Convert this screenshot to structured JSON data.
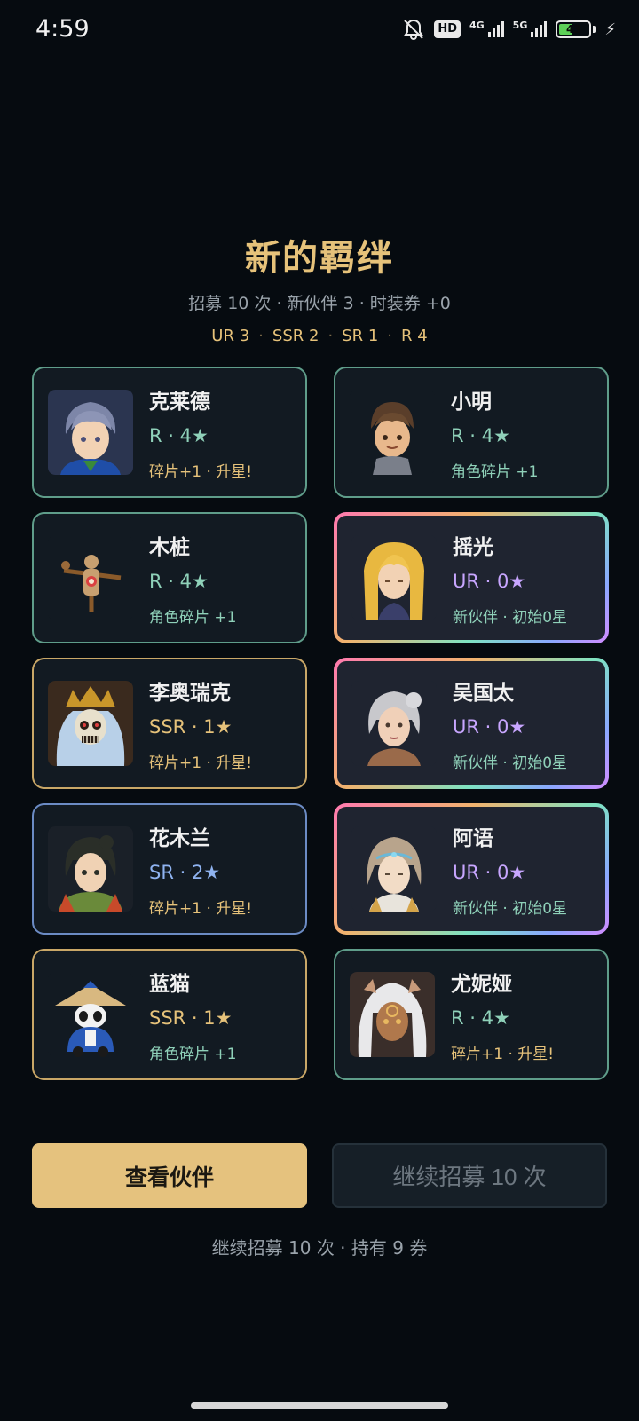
{
  "status_bar": {
    "time": "4:59",
    "hd_label": "HD",
    "net1": "4G",
    "net2": "5G",
    "battery": "43",
    "icons": [
      "bell-off-icon",
      "hd-icon",
      "signal-4g-icon",
      "signal-5g-icon",
      "battery-icon",
      "charging-icon"
    ]
  },
  "title": "新的羁绊",
  "summary": "招募 10 次 · 新伙伴 3 · 时装券 +0",
  "rarity_counts": [
    {
      "label": "UR 3"
    },
    {
      "label": "SSR 2"
    },
    {
      "label": "SR 1"
    },
    {
      "label": "R 4"
    }
  ],
  "cards": [
    {
      "name": "克莱德",
      "rank": "R · 4★",
      "rarity": "r",
      "note": "碎片+1 · 升星!",
      "note_color": "gold"
    },
    {
      "name": "小明",
      "rank": "R · 4★",
      "rarity": "r",
      "note": "角色碎片 +1",
      "note_color": "green"
    },
    {
      "name": "木桩",
      "rank": "R · 4★",
      "rarity": "r",
      "note": "角色碎片 +1",
      "note_color": "green"
    },
    {
      "name": "摇光",
      "rank": "UR · 0★",
      "rarity": "ur",
      "note": "新伙伴 · 初始0星",
      "note_color": "green"
    },
    {
      "name": "李奥瑞克",
      "rank": "SSR · 1★",
      "rarity": "ssr",
      "note": "碎片+1 · 升星!",
      "note_color": "gold"
    },
    {
      "name": "吴国太",
      "rank": "UR · 0★",
      "rarity": "ur",
      "note": "新伙伴 · 初始0星",
      "note_color": "green"
    },
    {
      "name": "花木兰",
      "rank": "SR · 2★",
      "rarity": "sr",
      "note": "碎片+1 · 升星!",
      "note_color": "gold"
    },
    {
      "name": "阿语",
      "rank": "UR · 0★",
      "rarity": "ur",
      "note": "新伙伴 · 初始0星",
      "note_color": "green"
    },
    {
      "name": "蓝猫",
      "rank": "SSR · 1★",
      "rarity": "ssr",
      "note": "角色碎片 +1",
      "note_color": "green"
    },
    {
      "name": "尤妮娅",
      "rank": "R · 4★",
      "rarity": "r",
      "note": "碎片+1 · 升星!",
      "note_color": "gold"
    }
  ],
  "buttons": {
    "view_partners": "查看伙伴",
    "continue_recruit": "继续招募 10 次"
  },
  "footer": "继续招募 10 次 · 持有 9 券",
  "colors": {
    "gold": "#e6c27a",
    "green": "#8fd1b9",
    "background": "#060b10"
  }
}
